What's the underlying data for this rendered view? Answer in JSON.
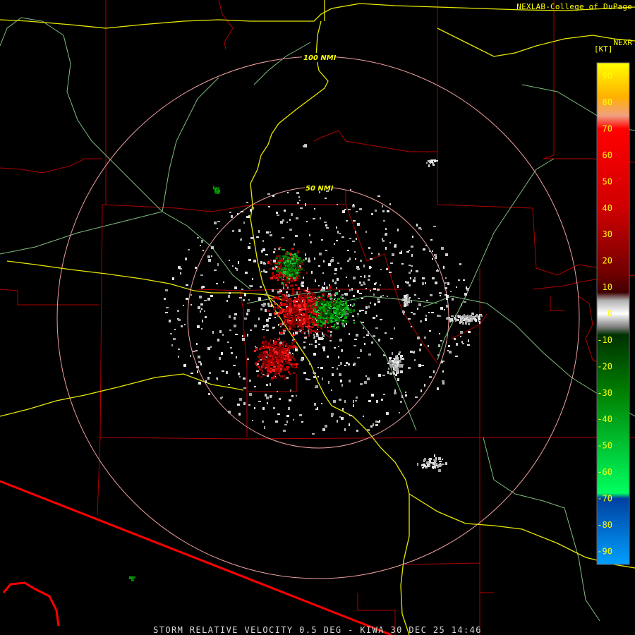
{
  "header": {
    "credit": "NEXLAB-College of DuPage",
    "product": "NEXR",
    "unit": "[KT]"
  },
  "footer": {
    "caption": "STORM RELATIVE VELOCITY 0.5 DEG - KIWA 30 DEC 25 14:46"
  },
  "range_rings": [
    {
      "label": "50 NMI"
    },
    {
      "label": "100 NMI"
    }
  ],
  "colorbar": {
    "ticks": [
      "90",
      "80",
      "70",
      "60",
      "50",
      "40",
      "30",
      "20",
      "10",
      "0",
      "-10",
      "-20",
      "-30",
      "-40",
      "-50",
      "-60",
      "-70",
      "-80",
      "-90"
    ],
    "stops": [
      {
        "v": 95,
        "color": "#ffff00"
      },
      {
        "v": 82,
        "color": "#ffb000"
      },
      {
        "v": 75,
        "color": "#f0a080"
      },
      {
        "v": 70,
        "color": "#ff0000"
      },
      {
        "v": 40,
        "color": "#d00000"
      },
      {
        "v": 15,
        "color": "#700000"
      },
      {
        "v": 8,
        "color": "#400000"
      },
      {
        "v": 5,
        "color": "#b0b0b0"
      },
      {
        "v": 0,
        "color": "#ffffff"
      },
      {
        "v": -5,
        "color": "#808080"
      },
      {
        "v": -8,
        "color": "#003000"
      },
      {
        "v": -30,
        "color": "#008000"
      },
      {
        "v": -68,
        "color": "#00ff60"
      },
      {
        "v": -70,
        "color": "#0040a0"
      },
      {
        "v": -95,
        "color": "#00a0ff"
      }
    ]
  },
  "colors": {
    "state_border": "#e00000",
    "county_border": "#b00000",
    "highway": "#e8e800",
    "road": "#7fbf7f",
    "ring": "#f0a0a0",
    "border_line": "#ff0000"
  }
}
